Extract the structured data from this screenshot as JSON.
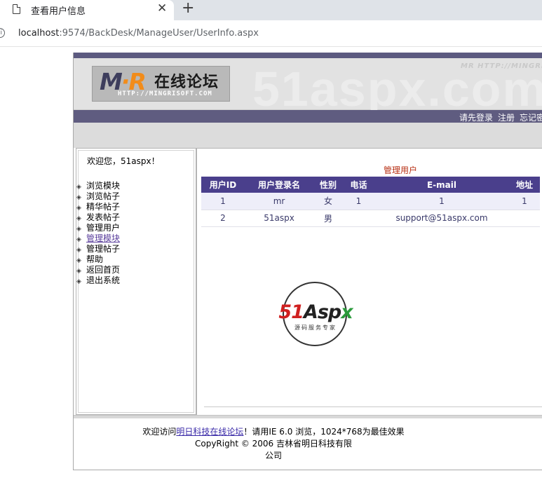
{
  "browser": {
    "tab_title": "查看用户信息",
    "tab_close": "✕",
    "new_tab": "+",
    "url_host": "localhost",
    "url_path": ":9574/BackDesk/ManageUser/UserInfo.aspx",
    "info_icon": "i"
  },
  "banner": {
    "logo_m": "M",
    "logo_r": "·R",
    "logo_cn": "在线论坛",
    "logo_url": "HTTP://MINGRISOFT.COM",
    "watermark": "51aspx.com",
    "watermark_small": "MR HTTP://MINGRI"
  },
  "nav": {
    "items": [
      "请先登录",
      "注册",
      "忘记密"
    ]
  },
  "sidebar": {
    "welcome": "欢迎您，51aspx！",
    "bullet": "◈",
    "items": [
      {
        "label": "浏览模块"
      },
      {
        "label": "浏览帖子"
      },
      {
        "label": "精华帖子"
      },
      {
        "label": "发表帖子"
      },
      {
        "label": "管理用户"
      },
      {
        "label": "管理模块"
      },
      {
        "label": "管理帖子"
      },
      {
        "label": "帮助"
      },
      {
        "label": "返回首页"
      },
      {
        "label": "退出系统"
      }
    ]
  },
  "main": {
    "title": "管理用户",
    "columns": [
      "用户ID",
      "用户登录名",
      "性别",
      "电话",
      "E-mail",
      "地址"
    ],
    "rows": [
      [
        "1",
        "mr",
        "女",
        "1",
        "1",
        "1"
      ],
      [
        "2",
        "51aspx",
        "男",
        "",
        "support@51aspx.com",
        ""
      ]
    ],
    "logo51": {
      "part1": "51",
      "part2": "Asp",
      "part3": "x",
      "sub": "源码服务专家"
    }
  },
  "footer": {
    "prefix": "欢迎访问",
    "link": "明日科技在线论坛",
    "suffix": "！请用IE 6.0 浏览，1024*768为最佳效果",
    "copyright": "CopyRight © 2006 吉林省明日科技有限",
    "company_tail": "公司"
  },
  "colors": {
    "nav_bar": "#5f5c80",
    "grid_header": "#4a3f8c",
    "title_red": "#b72e12",
    "link": "#3a2aa8"
  }
}
